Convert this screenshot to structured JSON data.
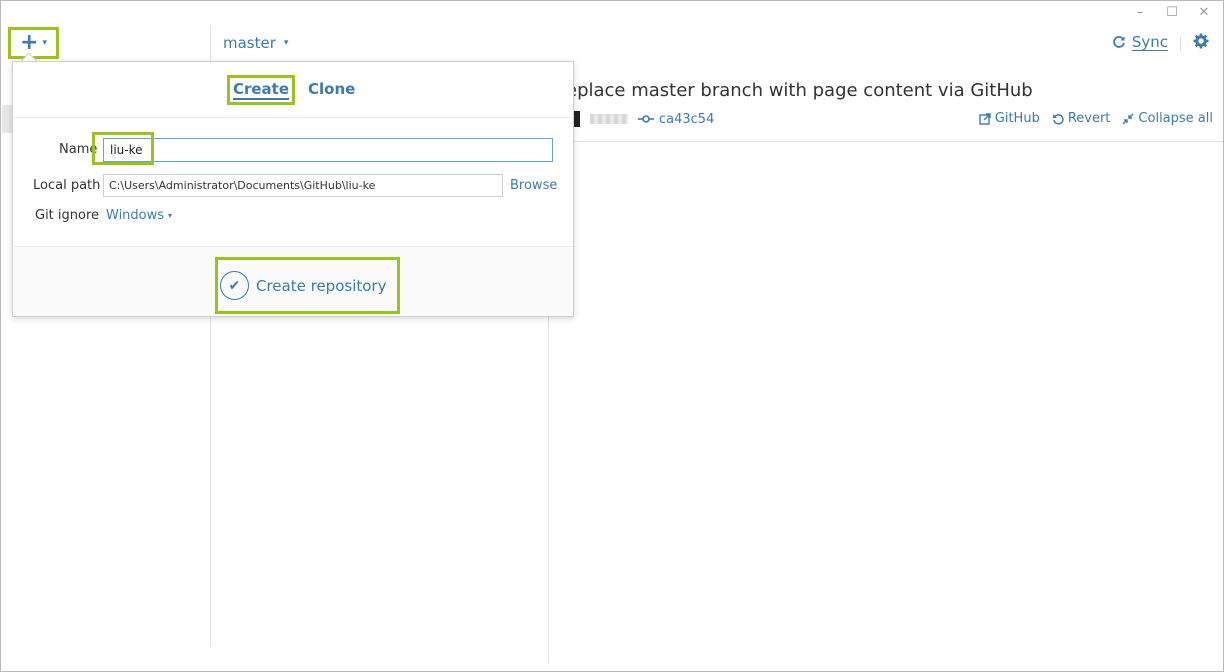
{
  "window": {
    "minimize_glyph": "–",
    "maximize_glyph": "☐",
    "close_glyph": "✕"
  },
  "toolbar": {
    "add_glyph": "+",
    "caret_glyph": "▾",
    "branch": "master",
    "sync_label": "Sync",
    "sync_icon": "sync-icon",
    "settings_icon": "gear-icon"
  },
  "commit": {
    "title": "eplace master branch with page content via GitHub",
    "sha": "ca43c54",
    "actions": {
      "github": "GitHub",
      "revert": "Revert",
      "collapse": "Collapse all"
    }
  },
  "popover": {
    "tabs": {
      "create": "Create",
      "clone": "Clone"
    },
    "fields": {
      "name_label": "Name",
      "name_value": "liu-ke",
      "local_path_label": "Local path",
      "local_path_value": "C:\\Users\\Administrator\\Documents\\GitHub\\liu-ke",
      "browse_label": "Browse",
      "gitignore_label": "Git ignore",
      "gitignore_value": "Windows"
    },
    "submit_label": "Create repository"
  },
  "colors": {
    "accent": "#3b7ab8",
    "highlight": "#9bc31c"
  }
}
